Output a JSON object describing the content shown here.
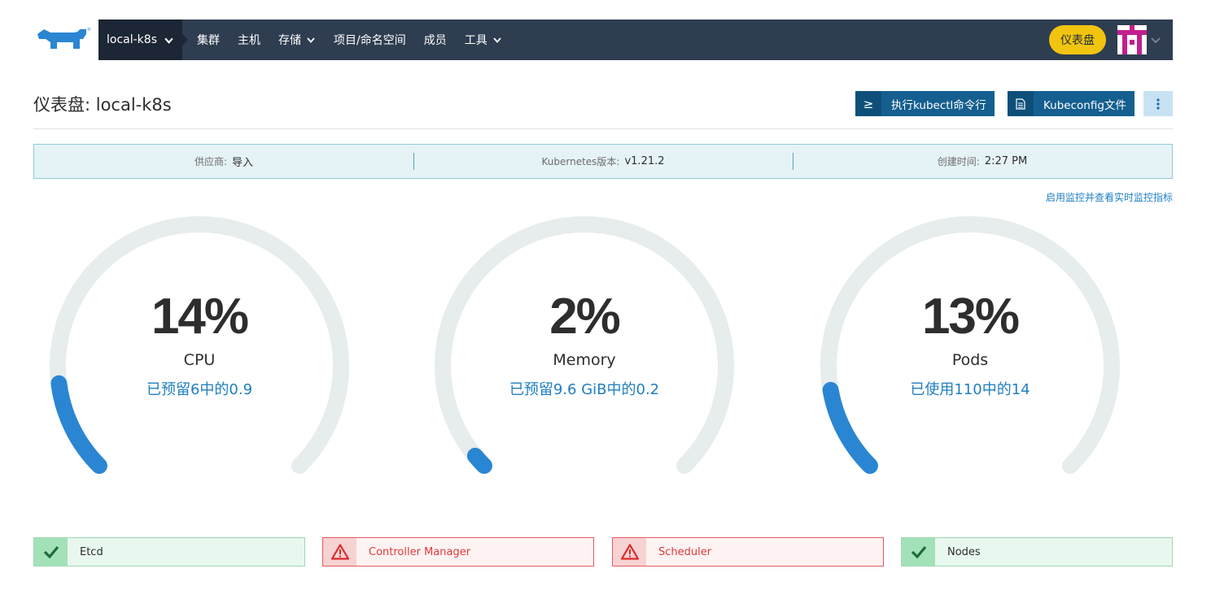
{
  "brand": {
    "logo_icon": "rancher-logo-icon"
  },
  "nav": {
    "cluster": "local-k8s",
    "items": [
      {
        "label": "集群",
        "dropdown": false
      },
      {
        "label": "主机",
        "dropdown": false
      },
      {
        "label": "存储",
        "dropdown": true
      },
      {
        "label": "项目/命名空间",
        "dropdown": false
      },
      {
        "label": "成员",
        "dropdown": false
      },
      {
        "label": "工具",
        "dropdown": true
      }
    ],
    "dashboard_pill": "仪表盘",
    "accent": "#f1c40f",
    "bar_color": "#2e3d50"
  },
  "header": {
    "title": "仪表盘: local-k8s",
    "kubectl_button": "执行kubectl命令行",
    "kubectl_icon": "≥",
    "kubeconfig_button": "Kubeconfig文件",
    "kubeconfig_icon": "file-icon",
    "more_icon": "kebab-menu-icon"
  },
  "info": {
    "provider_label": "供应商:",
    "provider_value": "导入",
    "k8s_label": "Kubernetes版本:",
    "k8s_value": "v1.21.2",
    "created_label": "创建时间:",
    "created_value": "2:27 PM"
  },
  "monitor_link": "启用监控并查看实时监控指标",
  "gauges": [
    {
      "percent_text": "14%",
      "percent": 14,
      "title": "CPU",
      "subtitle": "已预留6中的0.9"
    },
    {
      "percent_text": "2%",
      "percent": 2,
      "title": "Memory",
      "subtitle": "已预留9.6  GiB中的0.2"
    },
    {
      "percent_text": "13%",
      "percent": 13,
      "title": "Pods",
      "subtitle": "已使用110中的14"
    }
  ],
  "components": [
    {
      "label": "Etcd",
      "status": "ok"
    },
    {
      "label": "Controller Manager",
      "status": "error"
    },
    {
      "label": "Scheduler",
      "status": "error"
    },
    {
      "label": "Nodes",
      "status": "ok"
    }
  ],
  "colors": {
    "gauge_track": "#e7ecec",
    "gauge_fill": "#2a86d3",
    "link": "#1f7fc2"
  }
}
